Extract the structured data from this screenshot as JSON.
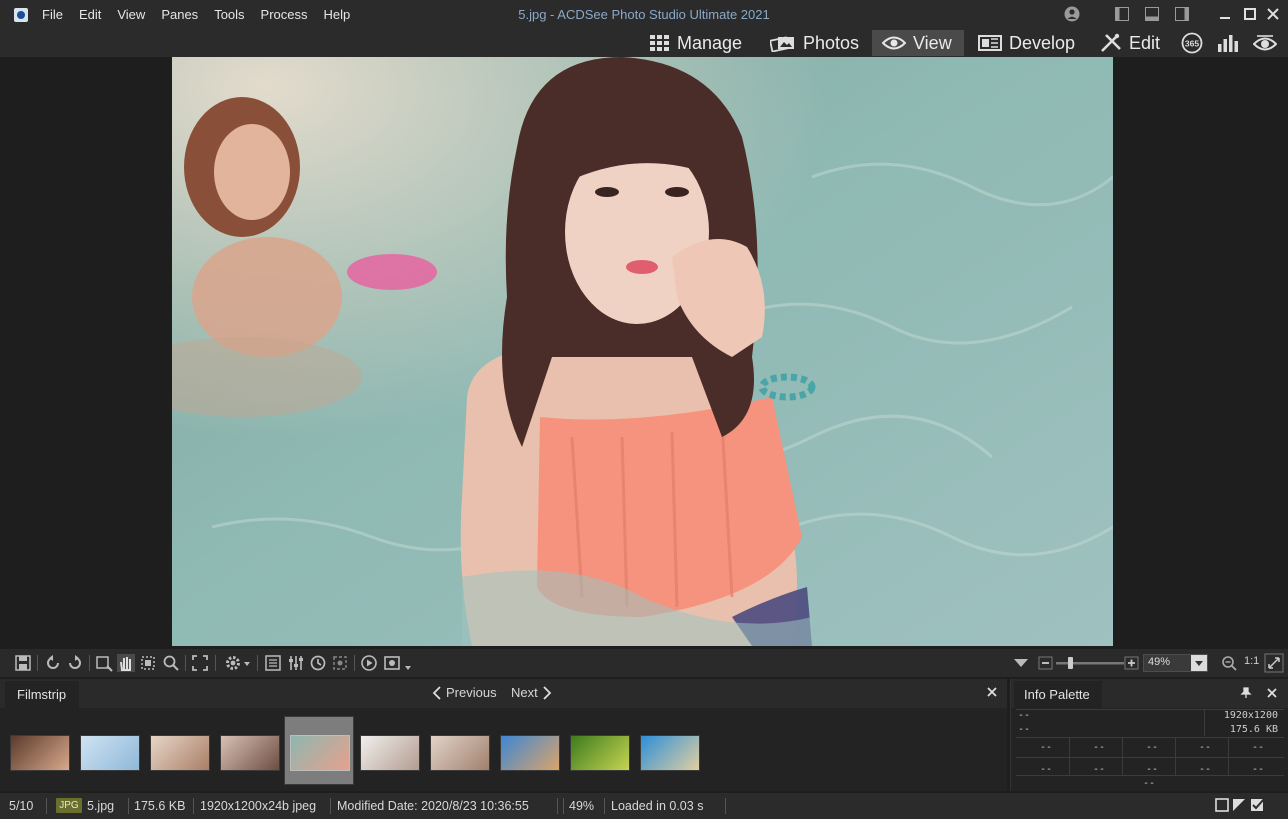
{
  "menu": [
    "File",
    "Edit",
    "View",
    "Panes",
    "Tools",
    "Process",
    "Help"
  ],
  "window_title": "5.jpg - ACDSee Photo Studio Ultimate 2021",
  "modes": {
    "manage": "Manage",
    "photos": "Photos",
    "view": "View",
    "develop": "Develop",
    "edit": "Edit",
    "badge_365": "365"
  },
  "toolbar": {
    "zoom_value": "49%",
    "one_to_one": "1:1"
  },
  "filmstrip": {
    "tab": "Filmstrip",
    "previous": "Previous",
    "next": "Next",
    "thumbnails": [
      {
        "colors": [
          "#5b3a2c",
          "#d8a98c"
        ]
      },
      {
        "colors": [
          "#cfe3f3",
          "#8fb8d8"
        ]
      },
      {
        "colors": [
          "#e8d6c8",
          "#a97f66"
        ]
      },
      {
        "colors": [
          "#d7c1b5",
          "#6d4d44"
        ]
      },
      {
        "colors": [
          "#8db6b0",
          "#e7a18c"
        ]
      },
      {
        "colors": [
          "#f1efee",
          "#b39c8f"
        ]
      },
      {
        "colors": [
          "#e2d3c9",
          "#a0806c"
        ]
      },
      {
        "colors": [
          "#3f87d2",
          "#d9a46a"
        ]
      },
      {
        "colors": [
          "#3d7b1e",
          "#c7d451"
        ]
      },
      {
        "colors": [
          "#2d8fd9",
          "#e1cfa0"
        ]
      }
    ],
    "selected_index": 4
  },
  "info_palette": {
    "tab": "Info Palette",
    "row1_left": "--",
    "row1_right": "1920x1200",
    "row2_left": "--",
    "row2_right": "175.6 KB",
    "grid_cell": "--",
    "bottom": "--"
  },
  "status": {
    "position": "5/10",
    "format": "JPG",
    "filename": "5.jpg",
    "filesize": "175.6 KB",
    "dimensions": "1920x1200x24b jpeg",
    "modified": "Modified Date: 2020/8/23 10:36:55",
    "zoom": "49%",
    "loaded": "Loaded in 0.03 s"
  },
  "colors": {
    "background": "#1e1e1e",
    "bar": "#2b2b2b",
    "active_tab": "#4a4a4a",
    "title_text": "#8aa9c9"
  }
}
